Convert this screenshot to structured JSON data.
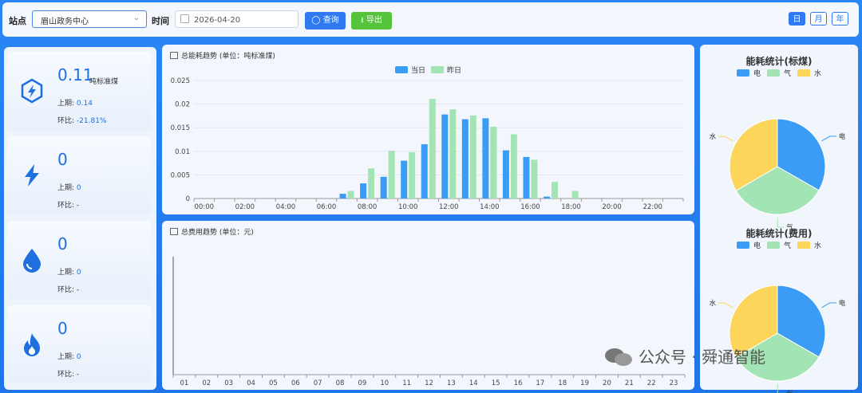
{
  "toolbar": {
    "station_label": "站点",
    "station_value": "眉山政务中心",
    "time_label": "时间",
    "date_value": "2026-04-20",
    "query_label": "查询",
    "export_label": "导出",
    "period_tabs": [
      {
        "label": "日",
        "active": true
      },
      {
        "label": "月",
        "active": false
      },
      {
        "label": "年",
        "active": false
      }
    ]
  },
  "metrics": [
    {
      "value": "0.11",
      "unit": "吨标准煤",
      "prev_label": "上期:",
      "prev_value": "0.14",
      "ratio_label": "环比:",
      "ratio_value": "-21.81%",
      "icon": "energy-hexagon-icon"
    },
    {
      "value": "0",
      "unit": "",
      "prev_label": "上期:",
      "prev_value": "0",
      "ratio_label": "环比:",
      "ratio_value": "-",
      "icon": "lightning-icon"
    },
    {
      "value": "0",
      "unit": "",
      "prev_label": "上期:",
      "prev_value": "0",
      "ratio_label": "环比:",
      "ratio_value": "-",
      "icon": "water-drop-icon"
    },
    {
      "value": "0",
      "unit": "",
      "prev_label": "上期:",
      "prev_value": "0",
      "ratio_label": "环比:",
      "ratio_value": "-",
      "icon": "flame-icon"
    }
  ],
  "energy_trend": {
    "title": "总能耗趋势 (单位：吨标准煤)"
  },
  "cost_trend": {
    "title": "总费用趋势 (单位：元)"
  },
  "pie_std": {
    "title": "能耗统计(标煤)"
  },
  "pie_cost": {
    "title": "能耗统计(费用)"
  },
  "watermark": "公众号 · 舜通智能",
  "colors": {
    "primary": "#2f7af0",
    "today": "#3a9cf5",
    "yesterday": "#a3e4b5",
    "elec": "#3a9cf5",
    "gas": "#a3e4b5",
    "water": "#fcd55a"
  },
  "chart_data": [
    {
      "type": "bar",
      "title": "总能耗趋势 (单位：吨标准煤)",
      "x_tick_labels": [
        "00:00",
        "02:00",
        "04:00",
        "06:00",
        "08:00",
        "10:00",
        "12:00",
        "14:00",
        "16:00",
        "18:00",
        "20:00",
        "22:00"
      ],
      "categories": [
        "0",
        "1",
        "2",
        "3",
        "4",
        "5",
        "6",
        "7",
        "8",
        "9",
        "10",
        "11",
        "12",
        "13",
        "14",
        "15",
        "16",
        "17",
        "18",
        "19",
        "20",
        "21",
        "22",
        "23"
      ],
      "y_ticks": [
        "0",
        "0.005",
        "0.01",
        "0.015",
        "0.02",
        "0.025"
      ],
      "ylim": [
        0,
        0.025
      ],
      "legend": "top-center",
      "series": [
        {
          "name": "当日",
          "values": [
            0,
            0,
            0,
            0,
            0,
            0,
            0,
            0.001,
            0.0032,
            0.0046,
            0.008,
            0.0115,
            0.0178,
            0.0168,
            0.017,
            0.0102,
            0.0088,
            0.0004,
            0,
            0,
            0,
            0,
            0,
            0
          ]
        },
        {
          "name": "昨日",
          "values": [
            0,
            0,
            0,
            0,
            0,
            0,
            0,
            0.0016,
            0.0064,
            0.0101,
            0.0098,
            0.0211,
            0.0189,
            0.0176,
            0.0152,
            0.0136,
            0.0082,
            0.0035,
            0.0016,
            0,
            0,
            0,
            0,
            0
          ]
        }
      ]
    },
    {
      "type": "bar",
      "title": "总费用趋势 (单位：元)",
      "categories": [
        "01",
        "02",
        "03",
        "04",
        "05",
        "06",
        "07",
        "08",
        "09",
        "10",
        "11",
        "12",
        "13",
        "14",
        "15",
        "16",
        "17",
        "18",
        "19",
        "20",
        "21",
        "22",
        "23"
      ],
      "series": []
    },
    {
      "type": "pie",
      "title": "能耗统计(标煤)",
      "legend": "top-center",
      "categories": [
        "电",
        "气",
        "水"
      ],
      "values": [
        33.3,
        33.3,
        33.4
      ]
    },
    {
      "type": "pie",
      "title": "能耗统计(费用)",
      "legend": "top-center",
      "categories": [
        "电",
        "气",
        "水"
      ],
      "values": [
        33.3,
        33.3,
        33.4
      ]
    }
  ]
}
